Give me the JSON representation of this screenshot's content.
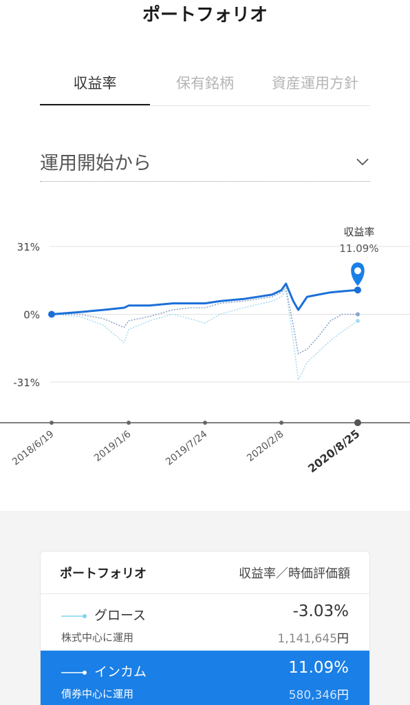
{
  "header": {
    "title": "ポートフォリオ"
  },
  "tabs": [
    {
      "label": "収益率",
      "active": true
    },
    {
      "label": "保有銘柄",
      "active": false
    },
    {
      "label": "資産運用方針",
      "active": false
    }
  ],
  "range_select": {
    "label": "運用開始から",
    "icon": "chevron-down-icon"
  },
  "marker": {
    "label": "収益率",
    "value": "11.09%",
    "icon": "map-pin-icon"
  },
  "chart_data": {
    "type": "line",
    "y_tick_labels": [
      "31%",
      "0%",
      "-31%"
    ],
    "ylim": [
      -31,
      31
    ],
    "x_tick_labels": [
      "2018/6/19",
      "2019/1/6",
      "2019/7/24",
      "2020/2/8",
      "2020/8/25"
    ],
    "x": [
      "2018/6/19",
      "2018/9/1",
      "2018/11/1",
      "2018/12/25",
      "2019/1/6",
      "2019/3/1",
      "2019/5/1",
      "2019/6/15",
      "2019/7/24",
      "2019/9/1",
      "2019/11/1",
      "2020/1/15",
      "2020/2/8",
      "2020/2/20",
      "2020/3/10",
      "2020/3/23",
      "2020/4/15",
      "2020/5/15",
      "2020/6/15",
      "2020/7/15",
      "2020/8/25"
    ],
    "series": [
      {
        "name": "インカム",
        "color": "#1a6fd9",
        "style": "solid",
        "values": [
          0,
          1,
          2,
          3,
          4,
          4,
          5,
          5,
          5,
          6,
          7,
          9,
          11,
          14,
          6,
          2,
          8,
          9,
          10,
          10.5,
          11.09
        ]
      },
      {
        "name": "",
        "color": "#8aa3c9",
        "style": "dotted",
        "values": [
          0,
          0,
          -2,
          -6,
          -3,
          -1,
          2,
          3,
          3,
          5,
          6,
          8,
          10,
          12,
          -5,
          -18,
          -16,
          -10,
          -3,
          0,
          0
        ]
      },
      {
        "name": "グロース",
        "color": "#a8dcef",
        "style": "dotted",
        "values": [
          0,
          -1,
          -5,
          -13,
          -7,
          -3,
          0,
          -2,
          -4,
          0,
          3,
          6,
          8,
          11,
          -12,
          -30,
          -22,
          -17,
          -12,
          -8,
          -3.03
        ]
      }
    ]
  },
  "summary": {
    "header_left": "ポートフォリオ",
    "header_right": "収益率／時価評価額",
    "rows": [
      {
        "name": "グロース",
        "return": "-3.03%",
        "subtitle": "株式中心に運用",
        "amount": "1,141,645",
        "unit": "円",
        "line_color": "#7fd3f0"
      },
      {
        "name": "インカム",
        "return": "11.09%",
        "subtitle": "債券中心に運用",
        "amount": "580,346",
        "unit": "円",
        "line_color": "#ffffff",
        "highlighted": true
      }
    ]
  }
}
